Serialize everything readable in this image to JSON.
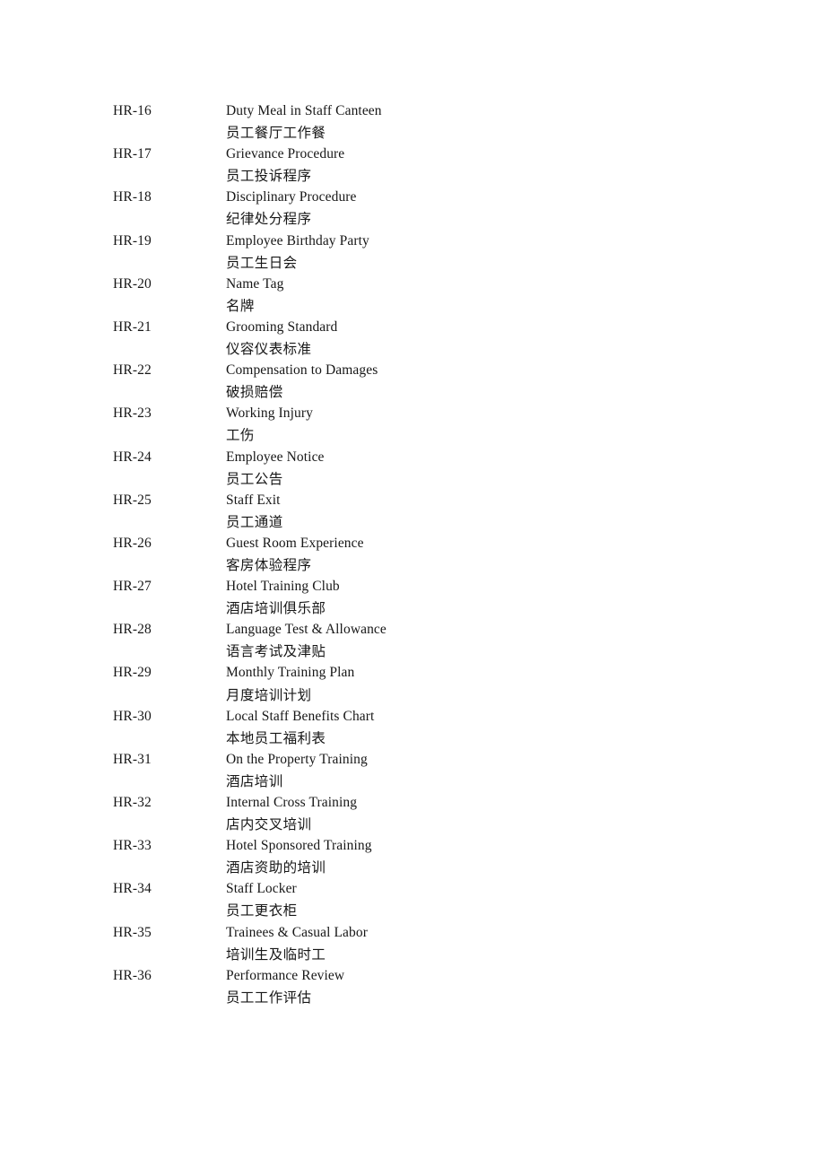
{
  "document": {
    "type": "policy-index-list",
    "text_color": "#171717",
    "page_background": "#ffffff"
  },
  "rows": [
    {
      "code": "HR-16",
      "title_en": "Duty Meal in Staff Canteen",
      "title_zh": "员工餐厅工作餐"
    },
    {
      "code": "HR-17",
      "title_en": "Grievance Procedure",
      "title_zh": "员工投诉程序"
    },
    {
      "code": "HR-18",
      "title_en": "Disciplinary Procedure",
      "title_zh": "纪律处分程序"
    },
    {
      "code": "HR-19",
      "title_en": "Employee Birthday Party",
      "title_zh": "员工生日会"
    },
    {
      "code": "HR-20",
      "title_en": "Name Tag",
      "title_zh": "名牌"
    },
    {
      "code": "HR-21",
      "title_en": "Grooming Standard",
      "title_zh": "仪容仪表标准"
    },
    {
      "code": "HR-22",
      "title_en": "Compensation to Damages",
      "title_zh": "破损赔偿"
    },
    {
      "code": "HR-23",
      "title_en": "Working Injury",
      "title_zh": "工伤"
    },
    {
      "code": "HR-24",
      "title_en": "Employee Notice",
      "title_zh": "员工公告"
    },
    {
      "code": "HR-25",
      "title_en": "Staff Exit",
      "title_zh": "员工通道"
    },
    {
      "code": "HR-26",
      "title_en": "Guest Room Experience",
      "title_zh": "客房体验程序"
    },
    {
      "code": "HR-27",
      "title_en": "Hotel Training Club",
      "title_zh": "酒店培训俱乐部"
    },
    {
      "code": "HR-28",
      "title_en": "Language Test & Allowance",
      "title_zh": "语言考试及津贴"
    },
    {
      "code": "HR-29",
      "title_en": "Monthly Training Plan",
      "title_zh": "月度培训计划"
    },
    {
      "code": "HR-30",
      "title_en": "Local Staff Benefits Chart",
      "title_zh": "本地员工福利表"
    },
    {
      "code": "HR-31",
      "title_en": "On the Property Training",
      "title_zh": "酒店培训"
    },
    {
      "code": "HR-32",
      "title_en": "Internal Cross Training",
      "title_zh": "店内交叉培训"
    },
    {
      "code": "HR-33",
      "title_en": "Hotel Sponsored Training",
      "title_zh": "酒店资助的培训"
    },
    {
      "code": "HR-34",
      "title_en": "Staff Locker",
      "title_zh": "员工更衣柜"
    },
    {
      "code": "HR-35",
      "title_en": "Trainees & Casual Labor",
      "title_zh": "培训生及临时工"
    },
    {
      "code": "HR-36",
      "title_en": "Performance Review",
      "title_zh": "员工工作评估"
    }
  ]
}
